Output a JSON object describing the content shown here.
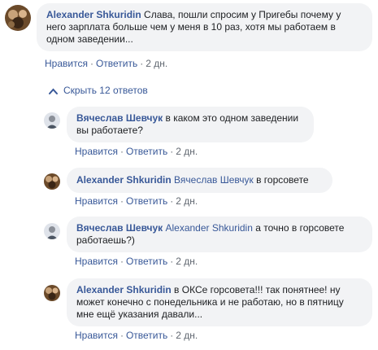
{
  "top_comment": {
    "author": "Alexander Shkuridin",
    "text": "Слава, пошли спросим у Пригебы почему у него зарплата больше чем у меня в 10 раз, хотя мы работаем в одном заведении...",
    "actions": {
      "like": "Нравится",
      "reply": "Ответить",
      "time": "2 дн."
    }
  },
  "collapse_replies_label": "Скрыть 12 ответов",
  "replies": [
    {
      "author": "Вячеслав Шевчук",
      "mention": "",
      "text": "в каком это одном заведении вы работаете?",
      "actions": {
        "like": "Нравится",
        "reply": "Ответить",
        "time": "2 дн."
      }
    },
    {
      "author": "Alexander Shkuridin",
      "mention": "Вячеслав Шевчук",
      "text": "в горсовете",
      "actions": {
        "like": "Нравится",
        "reply": "Ответить",
        "time": "2 дн."
      }
    },
    {
      "author": "Вячеслав Шевчук",
      "mention": "Alexander Shkuridin",
      "text": "а точно в горсовете работаешь?)",
      "actions": {
        "like": "Нравится",
        "reply": "Ответить",
        "time": "2 дн."
      }
    },
    {
      "author": "Alexander Shkuridin",
      "mention": "",
      "text": "в ОКСе горсовета!!! так понятнее! ну может конечно с понедельника и не работаю, но в пятницу мне ещё указания давали...",
      "actions": {
        "like": "Нравится",
        "reply": "Ответить",
        "time": "2 дн."
      }
    }
  ],
  "colors": {
    "link": "#385898",
    "bubble": "#f2f3f5",
    "meta": "#606770"
  }
}
